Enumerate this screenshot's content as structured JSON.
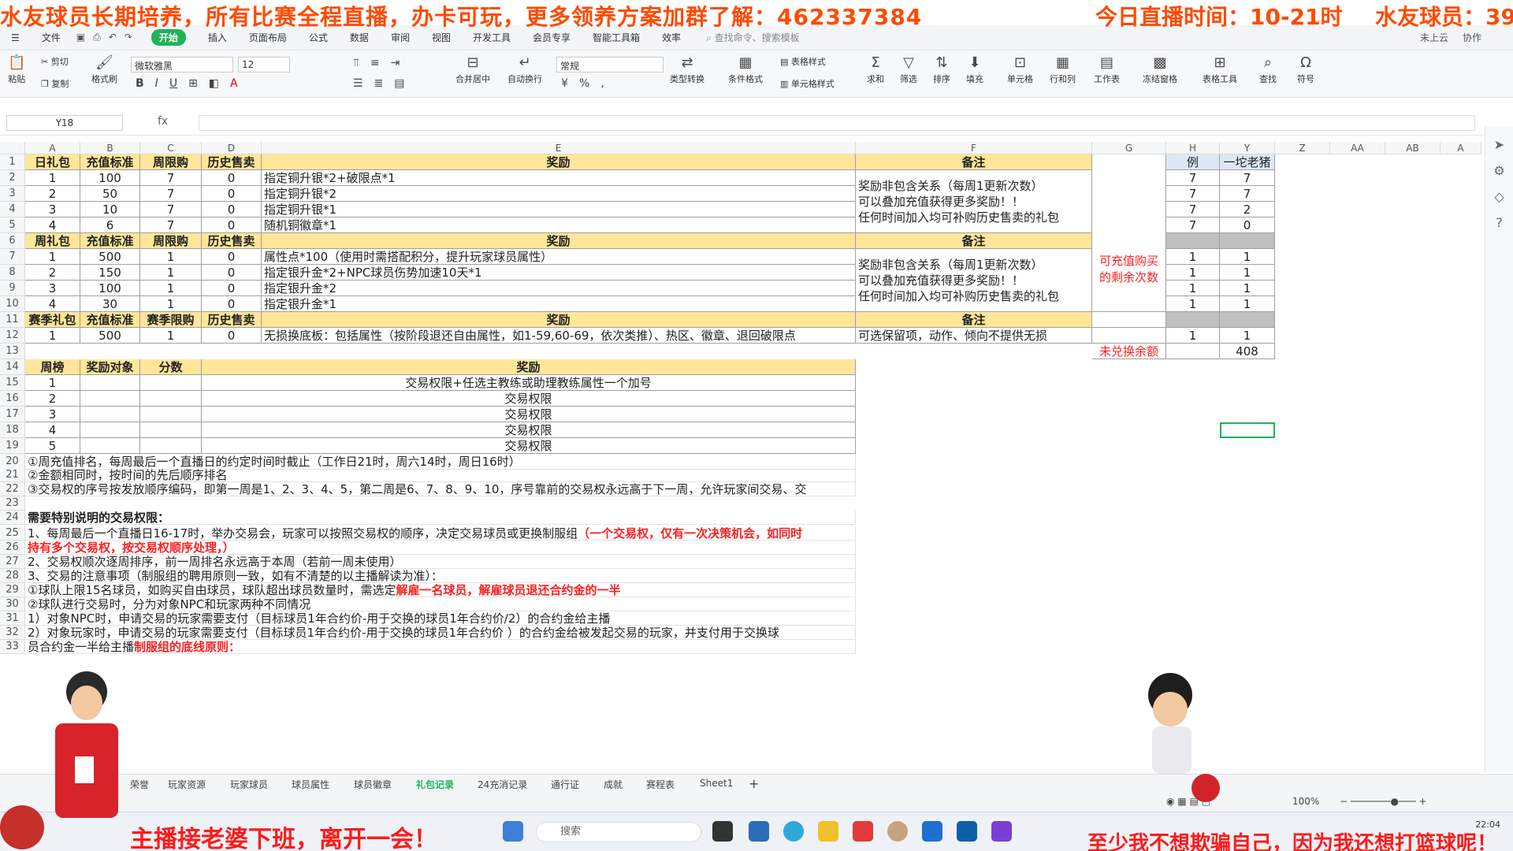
{
  "banner": {
    "left": "水友球员长期培养，所有比赛全程直播，办卡可玩，更多领养方案加群了解：462337384",
    "middle": "今日直播时间：10-21时",
    "right": "水友球员：39"
  },
  "menu": {
    "file": "文件",
    "items": [
      "开始",
      "插入",
      "页面布局",
      "公式",
      "数据",
      "审阅",
      "视图",
      "开发工具",
      "会员专享",
      "智能工具箱",
      "效率"
    ],
    "search": "查找命令、搜索模板",
    "right": [
      "未上云",
      "协作"
    ]
  },
  "ribbon": {
    "paste": "粘贴",
    "cut": "剪切",
    "copy": "复制",
    "format_painter": "格式刷",
    "font": "微软雅黑",
    "size": "12",
    "number_format": "常规",
    "merge": "合并居中",
    "wrap": "自动换行",
    "convert": "类型转换",
    "cond_format": "条件格式",
    "table_style": "表格样式",
    "cell_style": "单元格样式",
    "sum": "求和",
    "filter": "筛选",
    "sort": "排序",
    "fill": "填充",
    "cell": "单元格",
    "rowcol": "行和列",
    "worksheet": "工作表",
    "freeze": "冻结窗格",
    "table_tools": "表格工具",
    "find": "查找",
    "symbol": "符号"
  },
  "formula_bar": {
    "name_box": "Y18",
    "fx": "fx",
    "value": ""
  },
  "columns": [
    "A",
    "B",
    "C",
    "D",
    "E",
    "F",
    "G",
    "H",
    "Y",
    "Z",
    "AA",
    "AB",
    "A"
  ],
  "rows": [
    "1",
    "2",
    "3",
    "4",
    "5",
    "6",
    "7",
    "8",
    "9",
    "10",
    "11",
    "12",
    "13",
    "14",
    "15",
    "16",
    "17",
    "18",
    "19",
    "20",
    "21",
    "22",
    "23",
    "24",
    "25",
    "26",
    "27",
    "28",
    "29",
    "30",
    "31",
    "32",
    "33"
  ],
  "daily": {
    "headers": [
      "日礼包",
      "充值标准",
      "周限购",
      "历史售卖",
      "奖励",
      "备注"
    ],
    "rows": [
      [
        "1",
        "100",
        "7",
        "0",
        "指定铜升银*2+破限点*1"
      ],
      [
        "2",
        "50",
        "7",
        "0",
        "指定铜升银*2"
      ],
      [
        "3",
        "10",
        "7",
        "0",
        "指定铜升银*1"
      ],
      [
        "4",
        "6",
        "7",
        "0",
        "随机铜徽章*1"
      ]
    ],
    "note": [
      "奖励非包含关系（每周1更新次数）",
      "可以叠加充值获得更多奖励！！",
      "任何时间加入均可补购历史售卖的礼包"
    ]
  },
  "weekly": {
    "headers": [
      "周礼包",
      "充值标准",
      "周限购",
      "历史售卖",
      "奖励",
      "备注"
    ],
    "rows": [
      [
        "1",
        "500",
        "1",
        "0",
        "属性点*100（使用时需搭配积分，提升玩家球员属性）"
      ],
      [
        "2",
        "150",
        "1",
        "0",
        "指定银升金*2+NPC球员伤势加速10天*1"
      ],
      [
        "3",
        "100",
        "1",
        "0",
        "指定银升金*2"
      ],
      [
        "4",
        "30",
        "1",
        "0",
        "指定银升金*1"
      ]
    ],
    "note": [
      "奖励非包含关系（每周1更新次数）",
      "可以叠加充值获得更多奖励！！",
      "任何时间加入均可补购历史售卖的礼包"
    ]
  },
  "season": {
    "headers": [
      "赛季礼包",
      "充值标准",
      "赛季限购",
      "历史售卖",
      "奖励",
      "备注"
    ],
    "row": [
      "1",
      "500",
      "1",
      "0",
      "无损换底板：包括属性（按阶段退还自由属性，如1-59,60-69，依次类推）、热区、徽章、退回破限点",
      "可选保留项，动作、倾向不提供无损"
    ]
  },
  "remaining": {
    "g_label": "可充值购买的剩余次数",
    "h_header": "例",
    "y_header": "一坨老猪",
    "h": [
      "7",
      "7",
      "7",
      "7",
      "",
      "1",
      "1",
      "1",
      "1",
      "",
      "1"
    ],
    "y": [
      "7",
      "7",
      "2",
      "0",
      "",
      "1",
      "1",
      "1",
      "1",
      "",
      "1"
    ],
    "unredeemed_label": "未兑换余额",
    "unredeemed_value": "408"
  },
  "ranking": {
    "headers": [
      "周榜",
      "奖励对象",
      "分数",
      "奖励"
    ],
    "rows": [
      [
        "1",
        "交易权限+任选主教练或助理教练属性一个加号"
      ],
      [
        "2",
        "交易权限"
      ],
      [
        "3",
        "交易权限"
      ],
      [
        "4",
        "交易权限"
      ],
      [
        "5",
        "交易权限"
      ]
    ]
  },
  "notes": {
    "r20": "①周充值排名，每周最后一个直播日的约定时间时截止（工作日21时，周六14时，周日16时）",
    "r21": "②金额相同时，按时间的先后顺序排名",
    "r22": "③交易权的序号按发放顺序编码，即第一周是1、2、3、4、5，第二周是6、7、8、9、10，序号靠前的交易权永远高于下一周，允许玩家间交易、交",
    "r24": "需要特别说明的交易权限：",
    "r25a": "1、每周最后一个直播日16-17时，举办交易会，玩家可以按照交易权的顺序，决定交易球员或更换制服组",
    "r25b": "（一个交易权，仅有一次决策机会，如同时",
    "r26": "持有多个交易权，按交易权顺序处理，）",
    "r27": "2、交易权顺次逐周排序，前一周排名永远高于本周（若前一周未使用）",
    "r28": "3、交易的注意事项（制服组的聘用原则一致，如有不清楚的以主播解读为准）：",
    "r29a": "①球队上限15名球员，如购买自由球员，球队超出球员数量时，需选定",
    "r29b": "解雇一名球员，解雇球员退还合约金的一半",
    "r30": "②球队进行交易时，分为对象NPC和玩家两种不同情况",
    "r31": "1）对象NPC时，申请交易的玩家需要支付（目标球员1年合约价-用于交换的球员1年合约价/2）的合约金给主播",
    "r32": "2）对象玩家时，申请交易的玩家需要支付（目标球员1年合约价-用于交换的球员1年合约价 ）的合约金给被发起交易的玩家，并支付用于交换球",
    "r33": "员合约金一半给主播",
    "r34": "制服组的底线原则："
  },
  "sheet_tabs": [
    "荣誉",
    "玩家资源",
    "玩家球员",
    "球员属性",
    "球员徽章",
    "礼包记录",
    "24充消记录",
    "通行证",
    "成就",
    "赛程表",
    "Sheet1"
  ],
  "active_tab": "礼包记录",
  "status": {
    "zoom": "100%"
  },
  "taskbar": {
    "search": "搜索",
    "time": "22:04"
  },
  "overlay": {
    "bottom_left": "主播接老婆下班，离开一会！",
    "bottom_right": "至少我不想欺骗自己，因为我还想打篮球呢！"
  },
  "colors": {
    "header": "#ffe699",
    "accent": "#20b35a",
    "red": "#ff2020",
    "banner": "#ff4a00"
  }
}
